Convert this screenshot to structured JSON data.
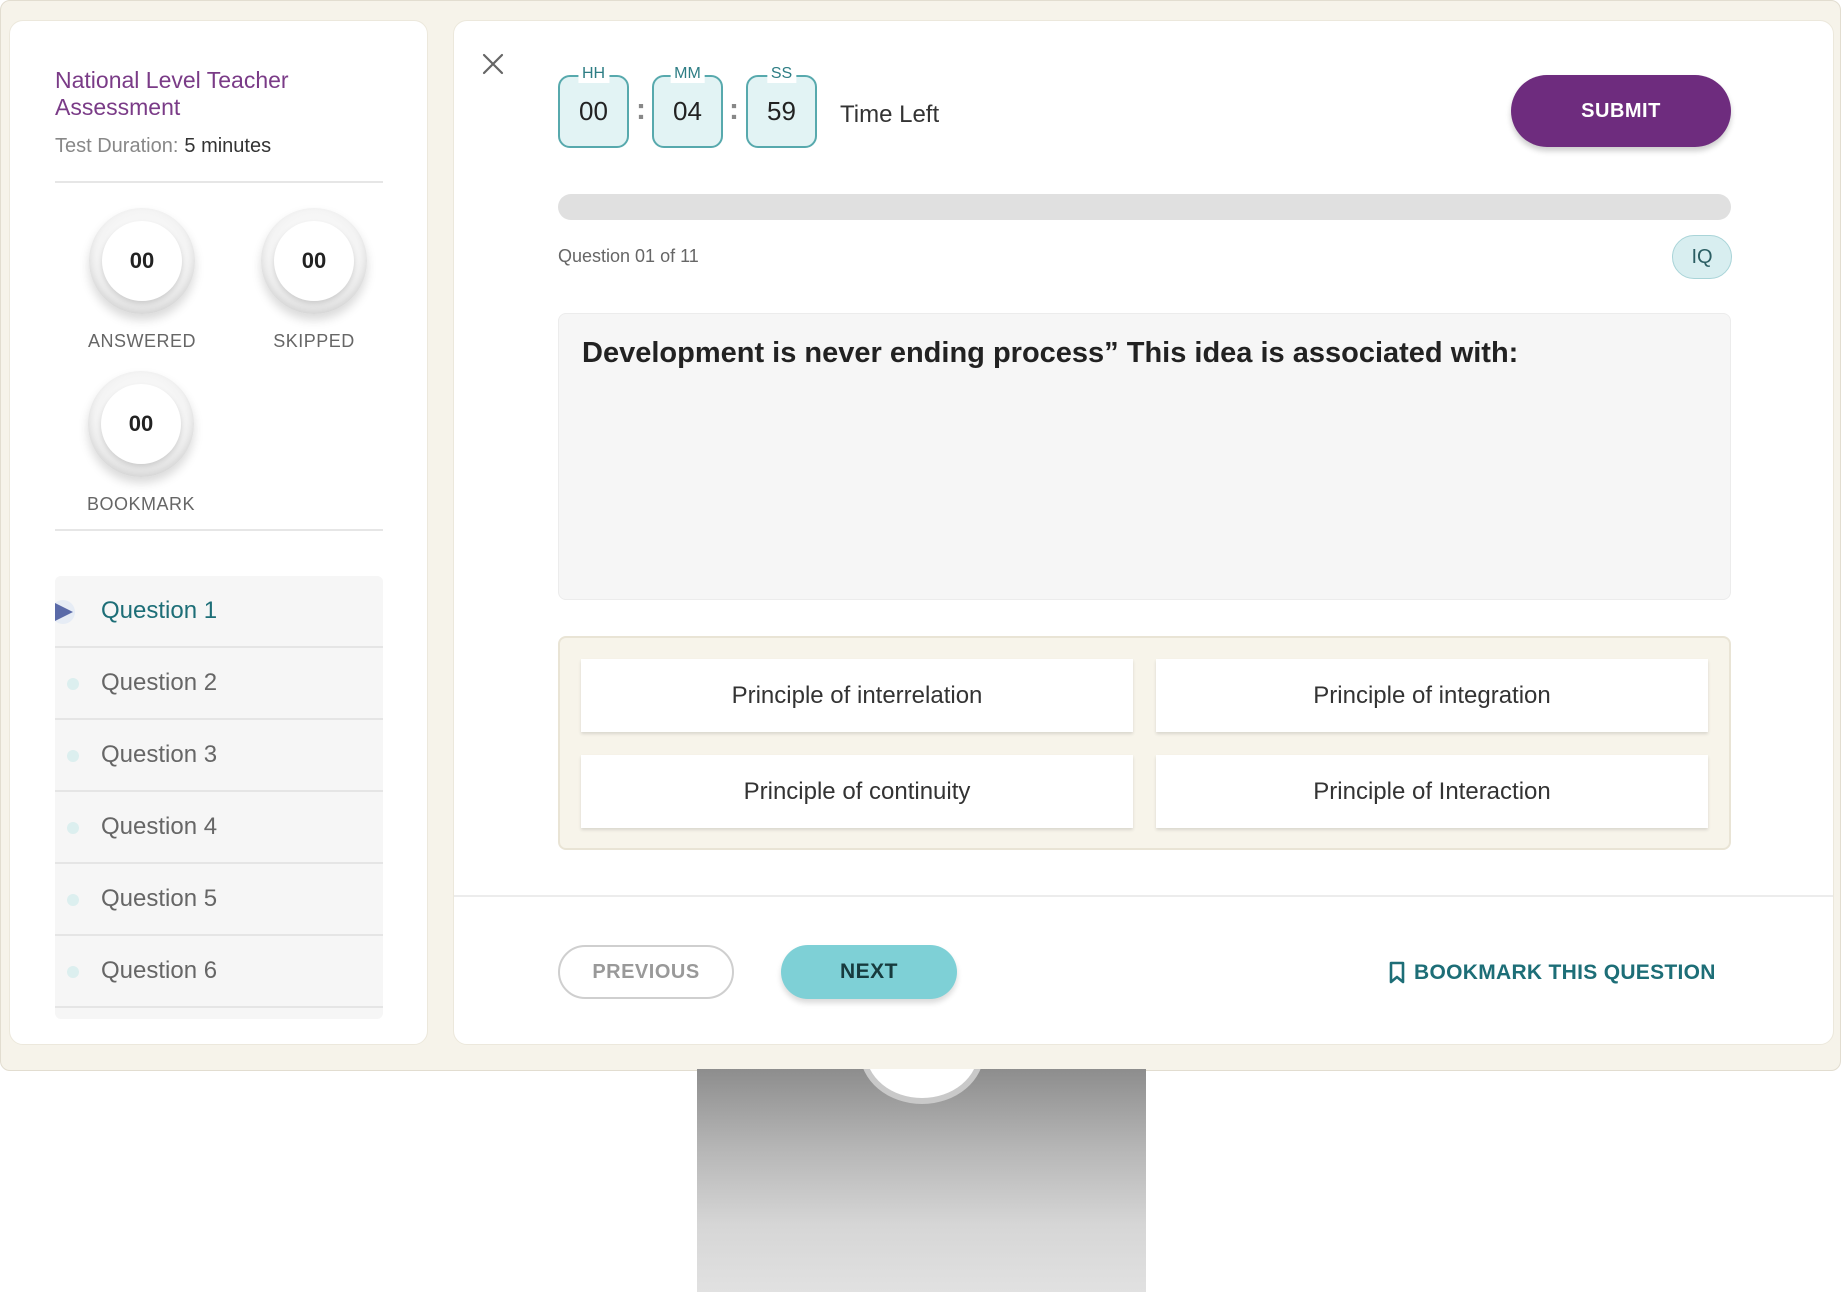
{
  "sidebar": {
    "test_title": "National Level Teacher Assessment",
    "duration_label": "Test Duration:",
    "duration_value": "5 minutes",
    "stats": [
      {
        "value": "00",
        "label": "ANSWERED"
      },
      {
        "value": "00",
        "label": "SKIPPED"
      },
      {
        "value": "00",
        "label": "BOOKMARK"
      }
    ],
    "questions": [
      {
        "label": "Question 1",
        "active": true
      },
      {
        "label": "Question 2",
        "active": false
      },
      {
        "label": "Question 3",
        "active": false
      },
      {
        "label": "Question 4",
        "active": false
      },
      {
        "label": "Question 5",
        "active": false
      },
      {
        "label": "Question 6",
        "active": false
      }
    ]
  },
  "header": {
    "close_icon": "close-icon",
    "timer": {
      "hh_label": "HH",
      "hh": "00",
      "mm_label": "MM",
      "mm": "04",
      "ss_label": "SS",
      "ss": "59",
      "time_left_label": "Time Left"
    },
    "submit_label": "SUBMIT"
  },
  "progress": {
    "fraction": 0.0,
    "counter_text": "Question 01 of 11",
    "category_badge": "IQ"
  },
  "question": {
    "text": "Development is never ending process” This idea is associated with:",
    "options": [
      "Principle of interrelation",
      "Principle of integration",
      "Principle of continuity",
      "Principle of Interaction"
    ]
  },
  "footer": {
    "previous_label": "PREVIOUS",
    "next_label": "NEXT",
    "bookmark_label": "BOOKMARK THIS QUESTION",
    "bookmark_icon": "bookmark-icon"
  },
  "colors": {
    "brand_purple": "#6e2c7e",
    "teal_accent": "#1d6e77",
    "next_button": "#7ed0d6"
  }
}
